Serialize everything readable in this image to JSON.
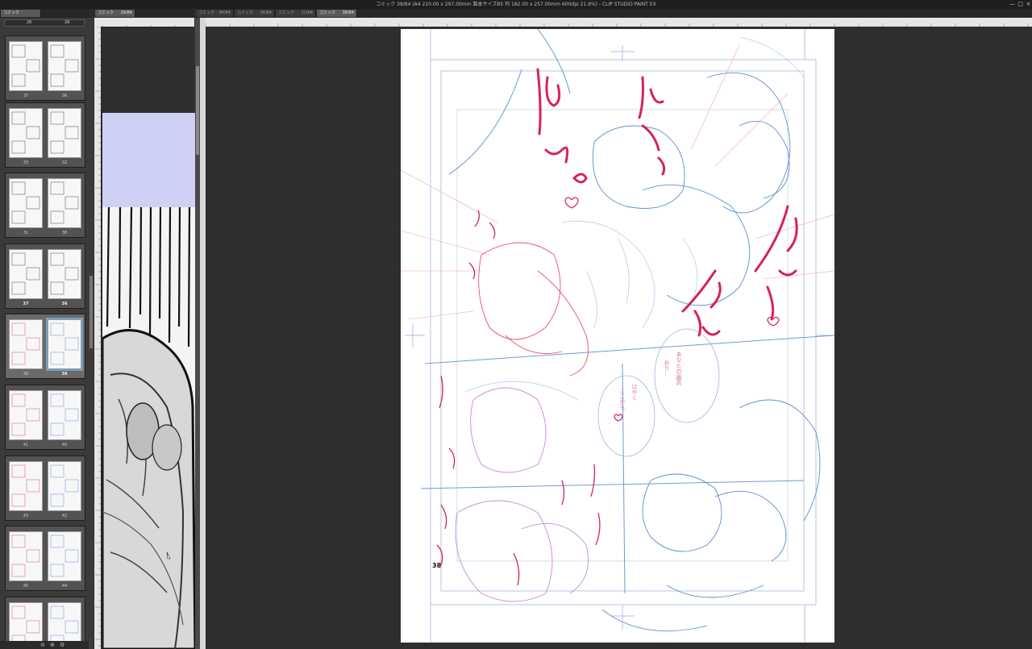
{
  "app": {
    "title": "コミック 38/84 (A4 210.00 x 297.00mm 製本サイズB5 判 182.00 x 257.00mm 600dpi 21.6%) - CLIP STUDIO PAINT EX"
  },
  "window_controls": [
    "minimize",
    "maximize",
    "close"
  ],
  "panel_tab": {
    "label": "コミック"
  },
  "subview_tab": {
    "label": "コミック",
    "page": "26/84"
  },
  "tabs": [
    {
      "label": "コミック",
      "page": "46/84"
    },
    {
      "label": "コミック",
      "page": "26/84"
    },
    {
      "label": "コミック",
      "page": "1/164"
    },
    {
      "label": "コミック",
      "page": "38/84"
    }
  ],
  "pagelist": {
    "header": {
      "left": "26",
      "right": "28"
    },
    "spreads": [
      {
        "left": "37",
        "right": "36"
      },
      {
        "left": "33",
        "right": "32"
      },
      {
        "left": "31",
        "right": "38"
      },
      {
        "left": "37",
        "right": "36"
      },
      {
        "left": "39",
        "right": "38"
      },
      {
        "left": "41",
        "right": "40"
      },
      {
        "left": "43",
        "right": "42"
      },
      {
        "left": "45",
        "right": "44"
      },
      {
        "left": "47",
        "right": "46"
      }
    ]
  },
  "page_number": "38",
  "colors": {
    "accent": "#d4235a",
    "blueline": "#5b8fd0",
    "redline": "#e8506a"
  }
}
